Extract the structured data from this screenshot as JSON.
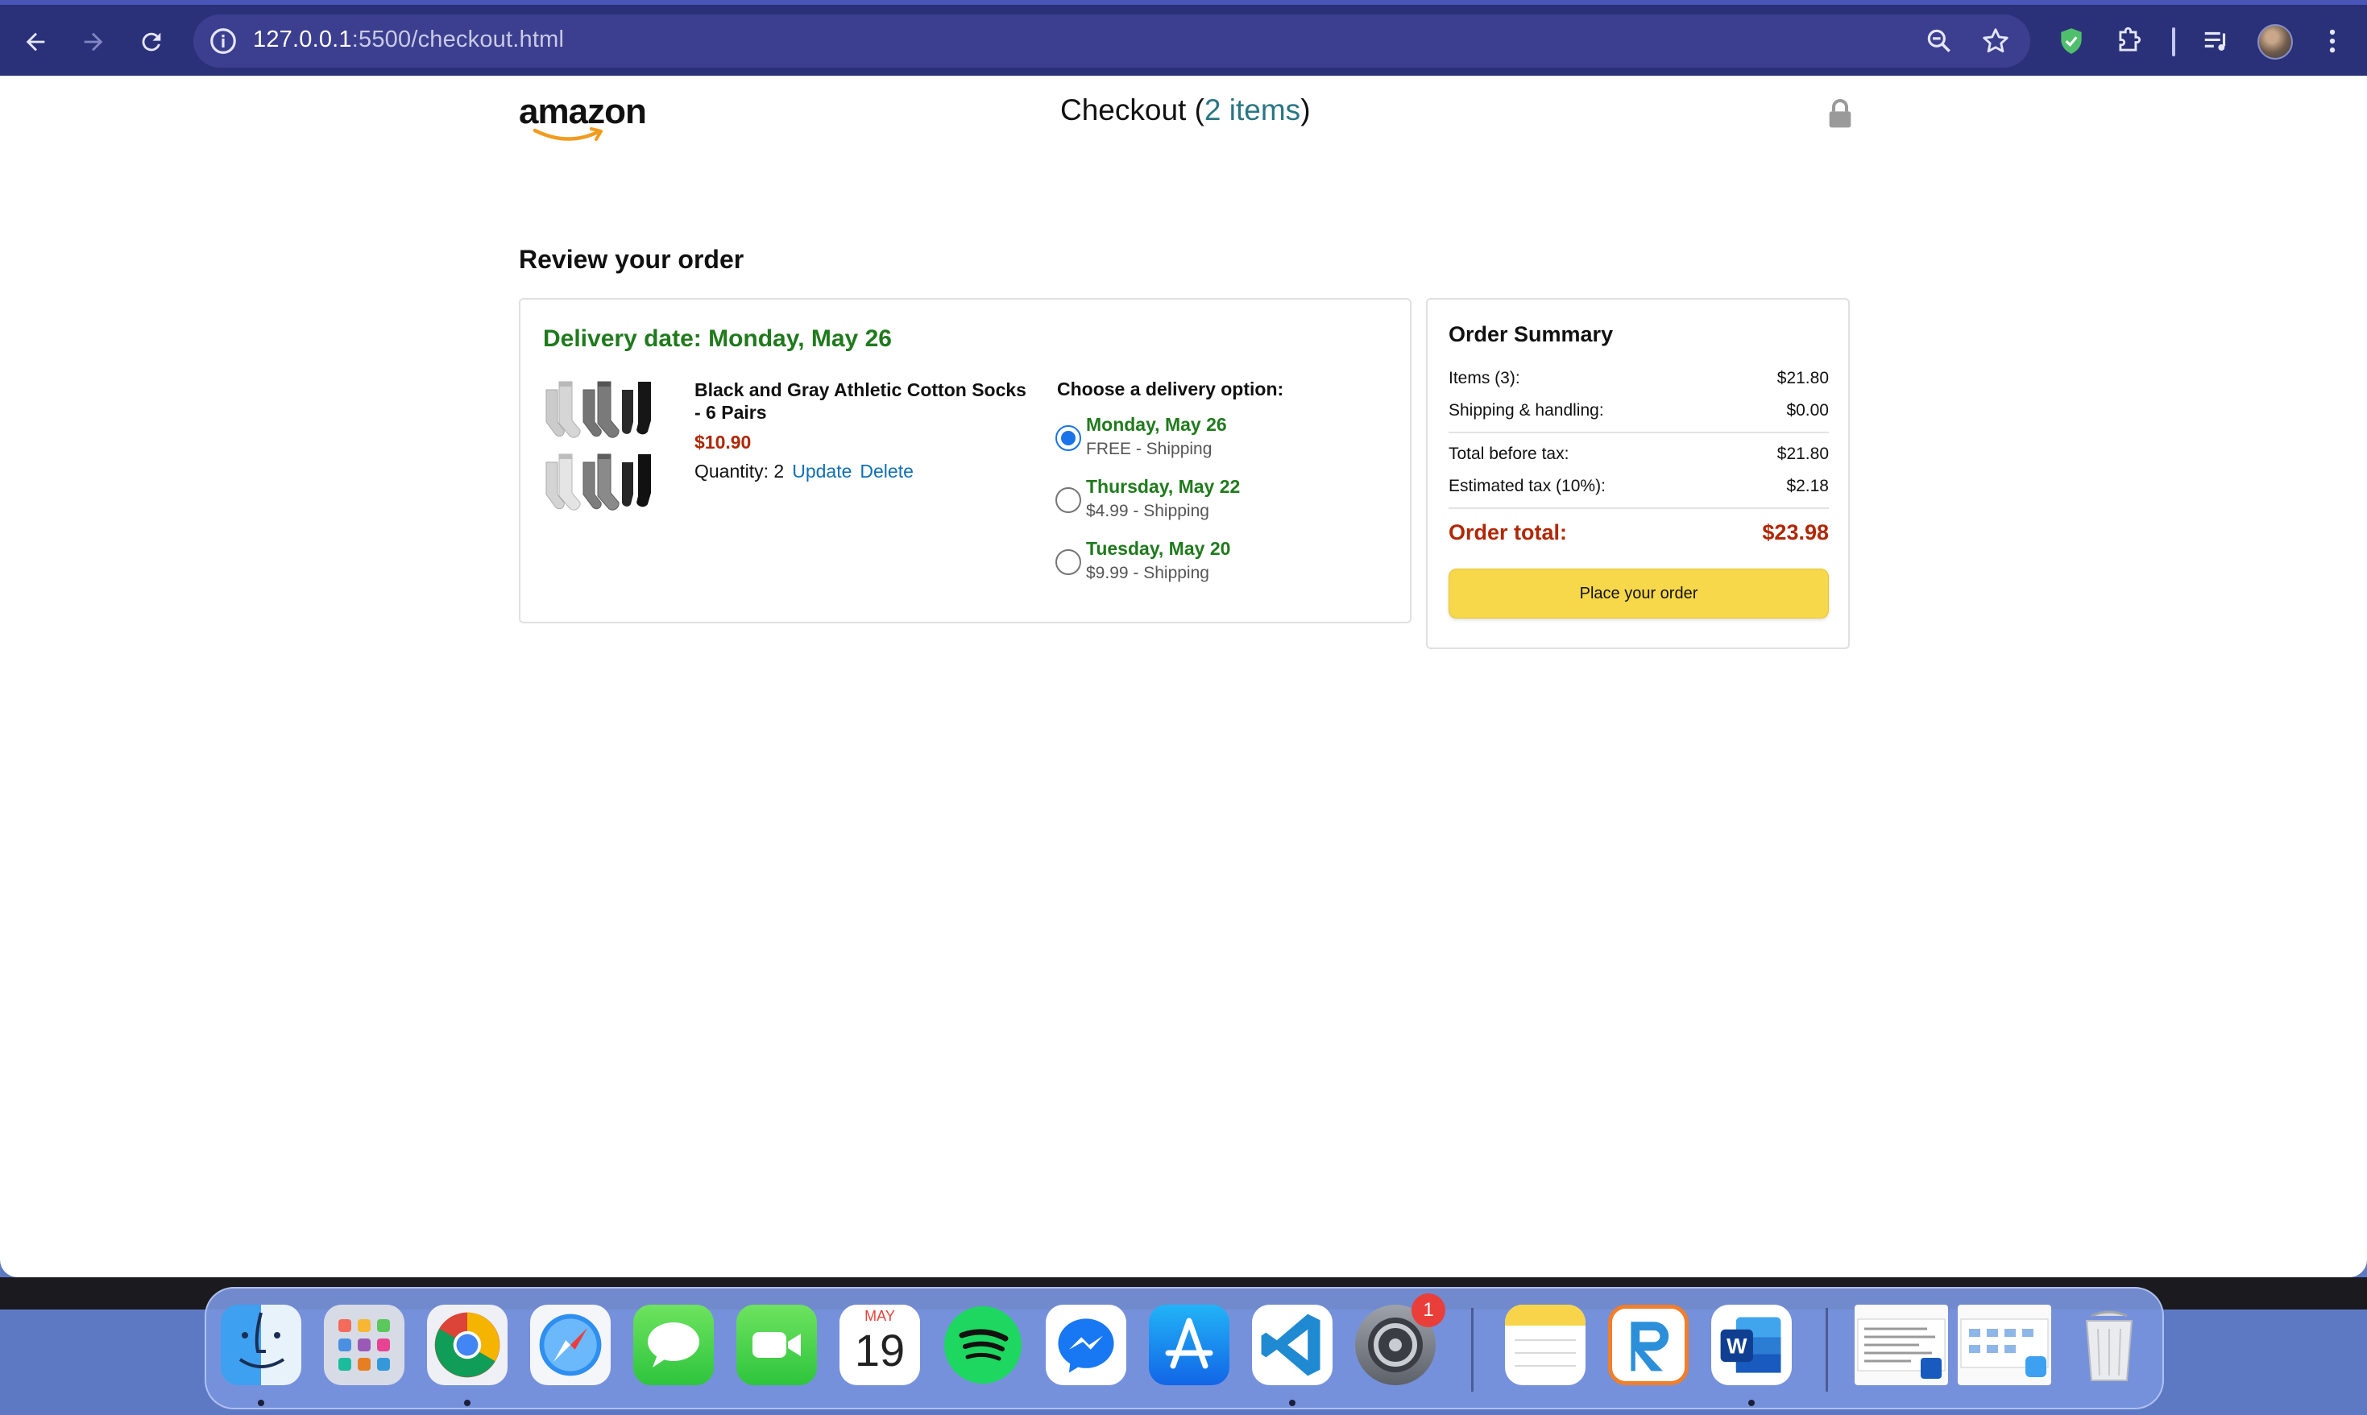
{
  "browser": {
    "url_host": "127.0.0.1",
    "url_rest": ":5500/checkout.html"
  },
  "header": {
    "logo_text": "amazon",
    "checkout_label": "Checkout (",
    "items_link": "2 items",
    "checkout_close": ")"
  },
  "review": {
    "title": "Review your order",
    "delivery_date": "Delivery date: Monday, May 26",
    "product": {
      "name": "Black and Gray Athletic Cotton Socks - 6 Pairs",
      "price": "$10.90",
      "quantity_label": "Quantity: 2",
      "update_label": "Update",
      "delete_label": "Delete"
    },
    "options_title": "Choose a delivery option:",
    "options": [
      {
        "date": "Monday, May 26",
        "price": "FREE - Shipping",
        "selected": true
      },
      {
        "date": "Thursday, May 22",
        "price": "$4.99 - Shipping",
        "selected": false
      },
      {
        "date": "Tuesday, May 20",
        "price": "$9.99 - Shipping",
        "selected": false
      }
    ]
  },
  "summary": {
    "title": "Order Summary",
    "items_label": "Items (3):",
    "items_value": "$21.80",
    "shipping_label": "Shipping & handling:",
    "shipping_value": "$0.00",
    "before_tax_label": "Total before tax:",
    "before_tax_value": "$21.80",
    "tax_label": "Estimated tax (10%):",
    "tax_value": "$2.18",
    "total_label": "Order total:",
    "total_value": "$23.98",
    "place_order_label": "Place your order"
  },
  "dock": {
    "calendar_month": "MAY",
    "calendar_day": "19",
    "settings_badge": "1",
    "apps": [
      "finder",
      "launchpad",
      "chrome",
      "safari",
      "messages",
      "facetime",
      "calendar",
      "spotify",
      "messenger",
      "app-store",
      "vscode",
      "system-settings",
      "notes",
      "rstudio",
      "word"
    ]
  },
  "colors": {
    "browser_frame": "#2b3178",
    "omnibox": "#3c3f8f",
    "delivery_green": "#207a1d",
    "price_red": "#b12704",
    "link_blue": "#0f6fb5",
    "items_teal": "#2a7684",
    "button_yellow": "#f7d84b"
  }
}
